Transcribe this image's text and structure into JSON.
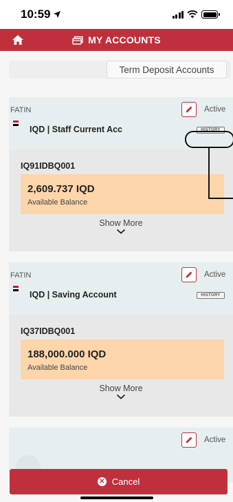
{
  "status_bar": {
    "time": "10:59"
  },
  "header": {
    "title": "MY ACCOUNTS"
  },
  "filter": {
    "label": "Term Deposit Accounts"
  },
  "accounts": [
    {
      "owner": "FATIN",
      "status": "Active",
      "name": "IQD | Staff Current Acc",
      "history_label": "HISTORY",
      "number": "IQ91IDBQ001",
      "balance": "2,609.737 IQD",
      "balance_label": "Available Balance",
      "show_more": "Show More"
    },
    {
      "owner": "FATIN",
      "status": "Active",
      "name": "IQD | Saving Account",
      "history_label": "HISTORY",
      "number": "IQ37IDBQ001",
      "balance": "188,000.000 IQD",
      "balance_label": "Available Balance",
      "show_more": "Show More"
    },
    {
      "status": "Active"
    }
  ],
  "footer": {
    "cancel_label": "Cancel"
  },
  "colors": {
    "brand": "#c0303c",
    "balance_bg": "#fdd5ab",
    "card_header": "#e6eef0"
  },
  "icons": {
    "home": "home-icon",
    "accounts": "accounts-icon",
    "edit": "pencil-icon",
    "flag": "iraq-flag-icon",
    "chevron": "chevron-down-icon",
    "cancel": "close-circle-icon"
  }
}
